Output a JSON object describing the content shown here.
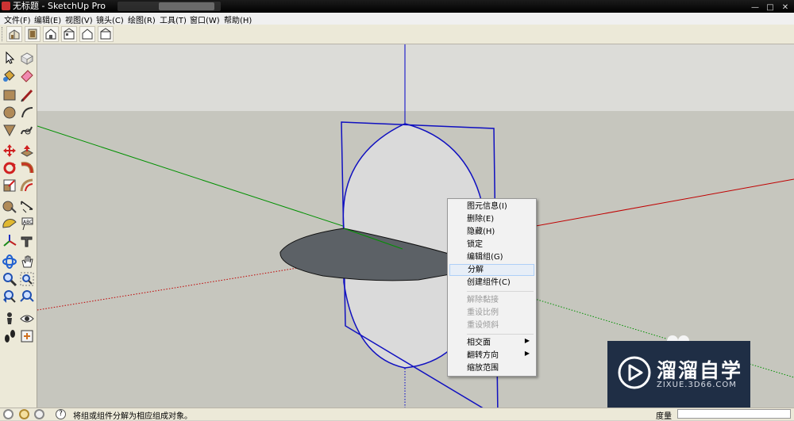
{
  "window": {
    "title": "无标题 - SketchUp Pro"
  },
  "menubar": [
    "文件(F)",
    "编辑(E)",
    "视图(V)",
    "镜头(C)",
    "绘图(R)",
    "工具(T)",
    "窗口(W)",
    "帮助(H)"
  ],
  "toolbar": {
    "views": [
      "iso-view-icon",
      "top-view-icon",
      "front-view-icon",
      "right-view-icon",
      "back-view-icon",
      "left-view-icon"
    ]
  },
  "palette": {
    "tools": [
      "select-icon",
      "make-component-icon",
      "paint-bucket-icon",
      "eraser-icon",
      "rectangle-icon",
      "line-icon",
      "circle-icon",
      "arc-icon",
      "polygon-icon",
      "freehand-icon",
      "move-icon",
      "push-pull-icon",
      "rotate-icon",
      "follow-me-icon",
      "scale-icon",
      "offset-icon",
      "tape-measure-icon",
      "dimension-icon",
      "protractor-icon",
      "text-icon",
      "axes-icon",
      "3d-text-icon",
      "orbit-icon",
      "pan-icon",
      "zoom-icon",
      "zoom-window-icon",
      "zoom-previous-icon",
      "zoom-extents-icon",
      "position-camera-icon",
      "look-around-icon",
      "walk-icon",
      "section-plane-icon"
    ]
  },
  "context_menu": {
    "items": [
      {
        "label": "图元信息(I)",
        "disabled": false
      },
      {
        "label": "删除(E)",
        "disabled": false
      },
      {
        "label": "隐藏(H)",
        "disabled": false
      },
      {
        "label": "锁定",
        "disabled": false
      },
      {
        "label": "编辑组(G)",
        "disabled": false
      },
      {
        "label": "分解",
        "disabled": false,
        "hover": true
      },
      {
        "label": "创建组件(C)",
        "disabled": false
      },
      {
        "label": "解除黏接",
        "disabled": true
      },
      {
        "label": "重设比例",
        "disabled": true
      },
      {
        "label": "重设倾斜",
        "disabled": true
      },
      {
        "label": "相交面",
        "disabled": false,
        "submenu": true
      },
      {
        "label": "翻转方向",
        "disabled": false,
        "submenu": true
      },
      {
        "label": "缩放范围",
        "disabled": false
      }
    ]
  },
  "watermark": {
    "brand": "溜溜自学",
    "url": "ZIXUE.3D66.COM"
  },
  "statusbar": {
    "message": "将组或组件分解为相应组成对象。",
    "measure_label": "度量",
    "measure_value": ""
  },
  "colors": {
    "sky": "#dcdcd8",
    "ground": "#c6c6be",
    "axis_red": "#c00000",
    "axis_green": "#009000",
    "axis_blue": "#0000c8",
    "selection": "#1010c0",
    "face_dark": "#5c6166",
    "face_light": "#dadada"
  }
}
